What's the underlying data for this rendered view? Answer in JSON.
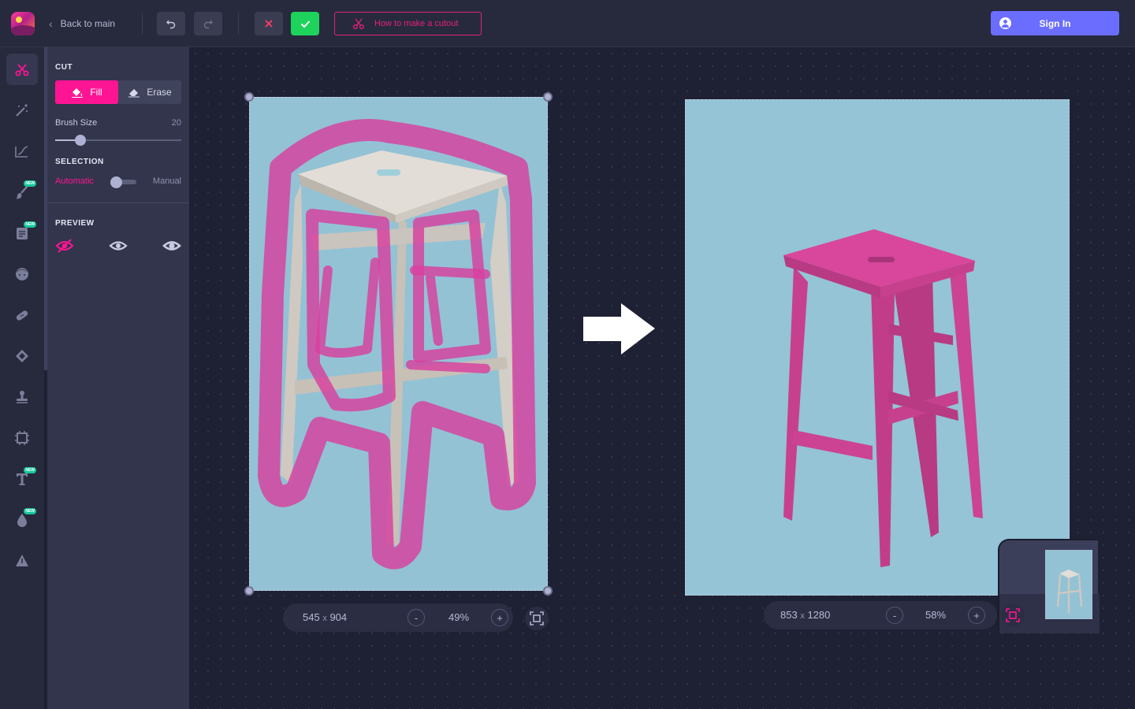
{
  "header": {
    "back_label": "Back to main",
    "howto_label": "How to make a cutout",
    "signin_label": "Sign In",
    "icons": [
      "app-logo",
      "chevron-left-icon",
      "undo-icon",
      "redo-icon",
      "close-icon",
      "check-icon",
      "scissors-icon",
      "user-icon"
    ],
    "colors": {
      "accent": "#ff1493",
      "confirm": "#1dd35b",
      "signin": "#6b6dff"
    }
  },
  "rail": {
    "tools": [
      {
        "name": "cutout",
        "icon": "scissors-icon",
        "active": true
      },
      {
        "name": "magic",
        "icon": "magic-wand-icon"
      },
      {
        "name": "adjust",
        "icon": "curve-adjust-icon"
      },
      {
        "name": "brush",
        "icon": "paint-brush-icon",
        "badge": "NEW"
      },
      {
        "name": "templates",
        "icon": "template-card-icon",
        "badge": "NEW"
      },
      {
        "name": "face",
        "icon": "face-icon"
      },
      {
        "name": "retouch",
        "icon": "bandage-icon"
      },
      {
        "name": "shape",
        "icon": "diamond-icon"
      },
      {
        "name": "stamp",
        "icon": "stamp-icon"
      },
      {
        "name": "crop",
        "icon": "crop-frame-icon"
      },
      {
        "name": "text",
        "icon": "text-icon",
        "badge": "NEW"
      },
      {
        "name": "fill",
        "icon": "color-drop-icon",
        "badge": "NEW"
      },
      {
        "name": "warning",
        "icon": "triangle-icon"
      }
    ]
  },
  "panel": {
    "cut": {
      "title": "CUT",
      "fill_label": "Fill",
      "erase_label": "Erase",
      "brush_label": "Brush Size",
      "brush_value": "20",
      "brush_level": 0.2
    },
    "selection": {
      "title": "SELECTION",
      "automatic_label": "Automatic",
      "manual_label": "Manual",
      "state": "Automatic"
    },
    "preview": {
      "title": "PREVIEW",
      "options": [
        "eye-off-icon",
        "eye-icon",
        "eye-bold-icon"
      ],
      "selected": "eye-off-icon"
    }
  },
  "left_image": {
    "dims_w": "545",
    "dims_x": "x",
    "dims_h": "904",
    "zoom": "49%",
    "minus": "-",
    "plus": "+"
  },
  "right_image": {
    "dims_w": "853",
    "dims_x": "x",
    "dims_h": "1280",
    "zoom": "58%",
    "minus": "-",
    "plus": "+"
  },
  "colors": {
    "backdrop": "#8fc0d3",
    "stool_wood": "#d8d3cc",
    "mask_pink": "#d8409f",
    "result_pink": "#d8479c"
  }
}
